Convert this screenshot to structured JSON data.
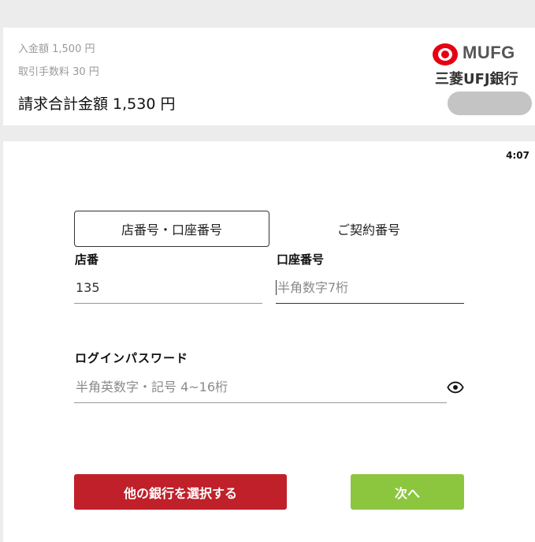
{
  "summary": {
    "deposit": "入金額 1,500 円",
    "fee": "取引手数料 30 円",
    "total": "請求合計金額 1,530 円"
  },
  "brand": {
    "name_en": "MUFG",
    "name_ja": "三菱UFJ銀行",
    "color": "#e60012"
  },
  "timer": "4:07",
  "tabs": [
    {
      "label": "店番号・口座番号",
      "active": true
    },
    {
      "label": "ご契約番号",
      "active": false
    }
  ],
  "form": {
    "branch": {
      "label": "店番",
      "value": "135",
      "placeholder": ""
    },
    "account": {
      "label": "口座番号",
      "value": "",
      "placeholder": "半角数字7桁"
    },
    "password": {
      "label": "ログインパスワード",
      "value": "",
      "placeholder": "半角英数字・記号 4~16桁"
    }
  },
  "buttons": {
    "other_bank": "他の銀行を選択する",
    "next": "次へ"
  },
  "colors": {
    "other_bank_button": "#c0202a",
    "next_button": "#8cc63f"
  }
}
